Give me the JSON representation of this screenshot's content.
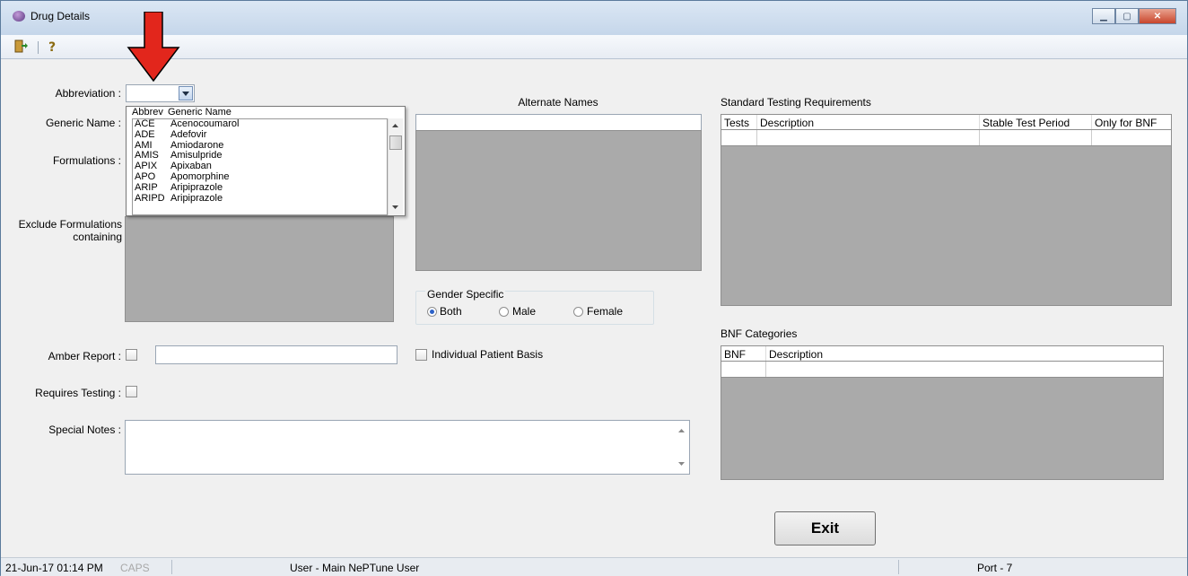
{
  "window": {
    "title": "Drug Details"
  },
  "toolbar": {
    "exit_icon": "door-exit-icon",
    "help_icon": "help-icon"
  },
  "form": {
    "abbreviation_label": "Abbreviation :",
    "abbreviation_value": "",
    "generic_name_label": "Generic Name :",
    "formulations_label": "Formulations :",
    "exclude_label_line1": "Exclude Formulations",
    "exclude_label_line2": "containing",
    "amber_report_label": "Amber Report :",
    "requires_testing_label": "Requires Testing :",
    "special_notes_label": "Special Notes :",
    "individual_patient_label": "Individual Patient Basis"
  },
  "dropdown": {
    "columns": [
      "Abbrev",
      "Generic Name"
    ],
    "rows": [
      [
        "ACE",
        "Acenocoumarol"
      ],
      [
        "ADE",
        "Adefovir"
      ],
      [
        "AMI",
        "Amiodarone"
      ],
      [
        "AMIS",
        "Amisulpride"
      ],
      [
        "APIX",
        "Apixaban"
      ],
      [
        "APO",
        "Apomorphine"
      ],
      [
        "ARIP",
        "Aripiprazole"
      ],
      [
        "ARIPD",
        "Aripiprazole"
      ]
    ]
  },
  "alternate_names": {
    "label": "Alternate Names"
  },
  "gender": {
    "legend": "Gender Specific",
    "options": [
      {
        "label": "Both",
        "selected": true
      },
      {
        "label": "Male",
        "selected": false
      },
      {
        "label": "Female",
        "selected": false
      }
    ]
  },
  "testing": {
    "label": "Standard Testing Requirements",
    "columns": [
      "Tests",
      "Description",
      "Stable Test Period",
      "Only for BNF"
    ]
  },
  "bnf": {
    "label": "BNF Categories",
    "columns": [
      "BNF",
      "Description"
    ]
  },
  "exit_label": "Exit",
  "status": {
    "datetime": "21-Jun-17 01:14 PM",
    "caps": "CAPS",
    "user": "User - Main NePTune User",
    "port": "Port - 7"
  },
  "colors": {
    "annotation_arrow": "#e2261c"
  }
}
